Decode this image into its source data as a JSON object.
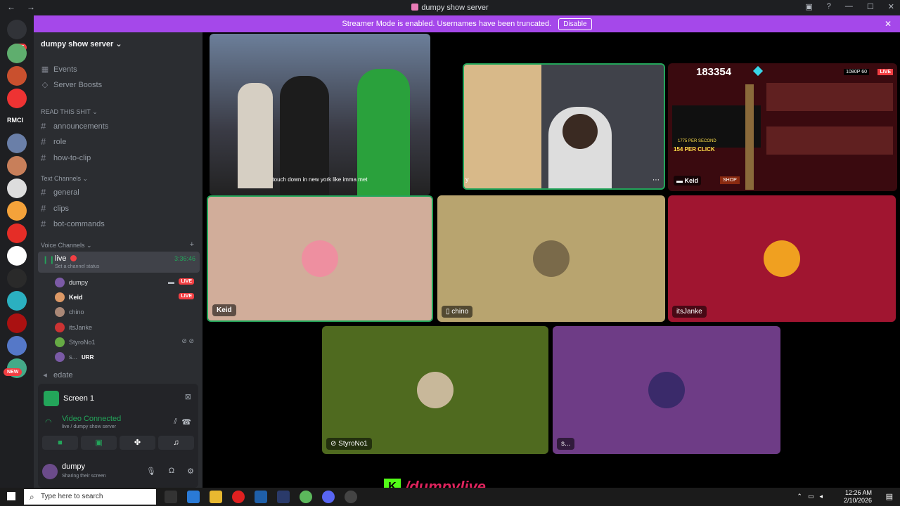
{
  "window": {
    "title": "dumpy show server",
    "back": "←",
    "forward": "→"
  },
  "banner": {
    "text": "Streamer Mode is enabled. Usernames have been truncated.",
    "button": "Disable"
  },
  "rail": {
    "badge": "685",
    "text_server": "RMCI",
    "new_tag": "NEW"
  },
  "server": {
    "name": "dumpy show server",
    "top_items": [
      {
        "label": "Events",
        "icon": "calendar-icon"
      },
      {
        "label": "Server Boosts",
        "icon": "boost-icon"
      }
    ],
    "categories": {
      "read": "READ THIS SHIT",
      "text": "Text Channels",
      "voice": "Voice Channels"
    },
    "read_channels": [
      "announcements",
      "role",
      "how-to-clip"
    ],
    "text_channels": [
      "general",
      "clips",
      "bot-commands"
    ],
    "voice": {
      "live_channel": "live",
      "timer": "3:36:46",
      "status_placeholder": "Set a channel status",
      "users": [
        {
          "name": "dumpy",
          "live": "LIVE"
        },
        {
          "name": "Keid",
          "live": "LIVE"
        },
        {
          "name": "chino"
        },
        {
          "name": "itsJanke"
        },
        {
          "name": "StyroNo1"
        },
        {
          "name": "s...",
          "extra": "URR"
        }
      ],
      "next_channel": "edate"
    }
  },
  "screen_panel": {
    "title": "Screen 1",
    "connected": "Video Connected",
    "sub": "live / dumpy show server"
  },
  "user": {
    "name": "dumpy",
    "status": "Sharing their screen"
  },
  "tiles": {
    "video_caption": "touch down in new york like imma met",
    "cam_label": "y",
    "game_score": "183354",
    "game_quality": "1080P 60",
    "game_live": "LIVE",
    "game_click": "154 PER CLICK",
    "game_per_second": "1775 PER SECOND",
    "game_user": "Keid",
    "game_shop": "SHOP",
    "keid": "Keid",
    "chino": "chino",
    "itsjanke": "itsJanke",
    "styro": "StyroNo1",
    "s": "s..."
  },
  "taskbar": {
    "search_placeholder": "Type here to search",
    "time": "12:26 AM",
    "date": "2/10/2026"
  },
  "overlay": {
    "handle": "/dumpylive",
    "k": "K"
  },
  "colors": {
    "accent": "#a548ea",
    "green": "#23a55a",
    "red": "#f23f43"
  }
}
